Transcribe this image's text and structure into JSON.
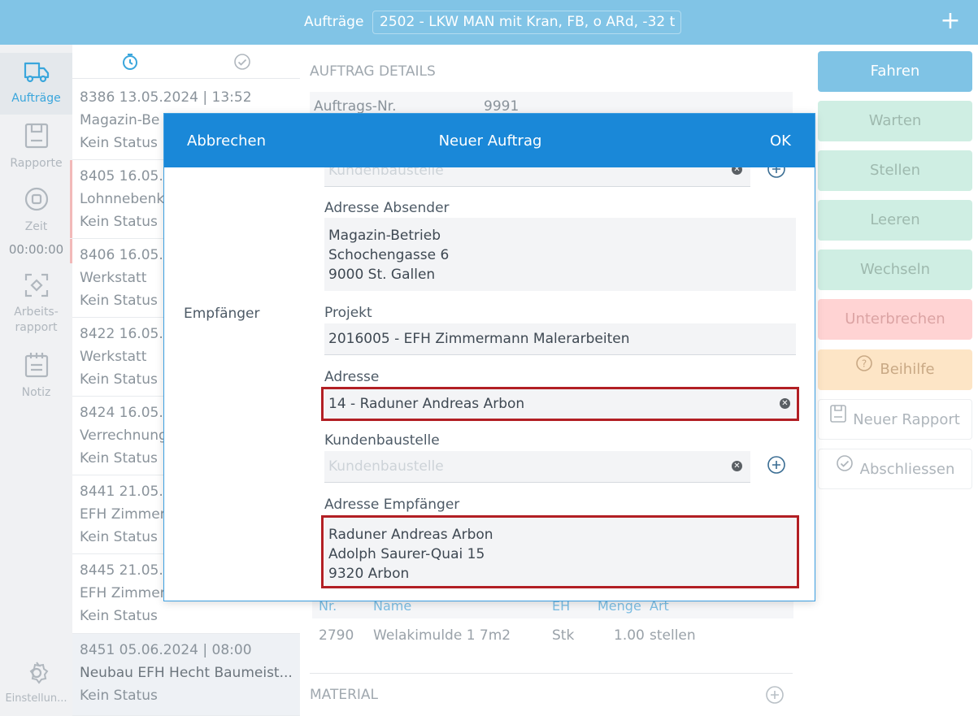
{
  "topbar": {
    "title": "Aufträge",
    "selected_job": "2502 - LKW MAN mit Kran, FB, o ARd, -32 t",
    "add_icon": "plus-icon"
  },
  "nav": {
    "items": [
      {
        "label": "Aufträge",
        "icon": "truck-icon",
        "active": true
      },
      {
        "label": "Rapporte",
        "icon": "clipboard-icon"
      },
      {
        "label": "Zeit",
        "icon": "record-icon"
      },
      {
        "label": "Arbeits-",
        "label2": "rapport",
        "icon": "focus-icon"
      },
      {
        "label": "Notiz",
        "icon": "notepad-icon"
      },
      {
        "label": "Einstellun...",
        "icon": "gear-icon"
      }
    ],
    "timer": "00:00:00"
  },
  "list": {
    "filter_icons": [
      "timer-icon",
      "check-circle-icon"
    ],
    "jobs": [
      {
        "line1": "8386  13.05.2024 | 13:52",
        "line2": "Magazin-Be",
        "line3": "Kein Status"
      },
      {
        "line1": "8405  16.05.",
        "line2": "Lohnnebenk",
        "line3": "Kein Status"
      },
      {
        "line1": "8406  16.05.",
        "line2": "Werkstatt",
        "line3": "Kein Status"
      },
      {
        "line1": "8422  16.05.",
        "line2": "Werkstatt",
        "line3": "Kein Status"
      },
      {
        "line1": "8424  16.05.",
        "line2": "Verrechnung",
        "line3": "Kein Status"
      },
      {
        "line1": "8441  21.05.",
        "line2": "EFH Zimmer",
        "line3": "Kein Status"
      },
      {
        "line1": "8445  21.05.",
        "line2": "EFH Zimmer",
        "line3": "Kein Status"
      },
      {
        "line1": "8451  05.06.2024 | 08:00",
        "line2": "Neubau EFH Hecht Baumeist...",
        "line3": "Kein Status"
      }
    ]
  },
  "detail": {
    "header": "AUFTRAG DETAILS",
    "order_no_label": "Auftrags-Nr.",
    "order_no": "9991",
    "table_headers": [
      "Nr.",
      "Name",
      "EH",
      "Menge",
      "Art"
    ],
    "table_row": [
      "2790",
      "Welakimulde 1 7m2",
      "Stk",
      "1.00",
      "stellen"
    ],
    "material_label": "MATERIAL"
  },
  "actions": {
    "fahren": "Fahren",
    "warten": "Warten",
    "stellen": "Stellen",
    "leeren": "Leeren",
    "wechseln": "Wechseln",
    "unterbrechen": "Unterbrechen",
    "beihilfe": "Beihilfe",
    "neuer_rapport": "Neuer Rapport",
    "abschliessen": "Abschliessen"
  },
  "modal": {
    "cancel": "Abbrechen",
    "title": "Neuer Auftrag",
    "ok": "OK",
    "section_label": "Empfänger",
    "top_field_placeholder": "Kundenbaustelle",
    "adresse_absender_label": "Adresse Absender",
    "adresse_absender": [
      "Magazin-Betrieb",
      "Schochengasse 6",
      "9000 St. Gallen"
    ],
    "projekt_label": "Projekt",
    "projekt": "2016005 - EFH Zimmermann Malerarbeiten",
    "adresse_label": "Adresse",
    "adresse": "14 - Raduner Andreas Arbon",
    "kundenbaustelle_label": "Kundenbaustelle",
    "kundenbaustelle_placeholder": "Kundenbaustelle",
    "adresse_empfaenger_label": "Adresse Empfänger",
    "adresse_empfaenger": [
      "Raduner Andreas Arbon",
      "Adolph Saurer-Quai 15",
      "9320 Arbon"
    ]
  },
  "colors": {
    "topbar": "#81c4e6",
    "modal_bar": "#1a88d8",
    "highlight": "#b21f24",
    "accent": "#3aa6dc"
  }
}
